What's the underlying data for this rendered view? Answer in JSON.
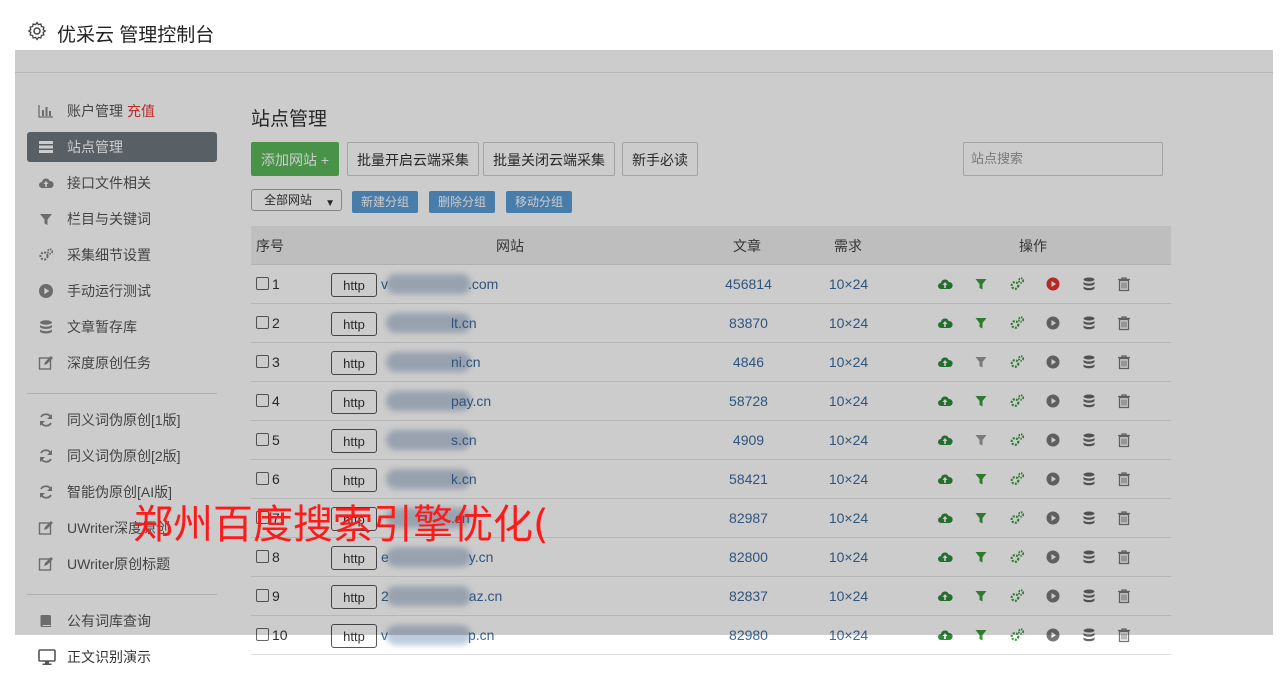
{
  "app": {
    "title": "优采云 管理控制台"
  },
  "sidebar": {
    "items": [
      {
        "label": "账户管理",
        "extra": "充值",
        "icon": "bar-chart-icon"
      },
      {
        "label": "站点管理",
        "icon": "list-icon",
        "active": true
      },
      {
        "label": "接口文件相关",
        "icon": "cloud-upload-icon"
      },
      {
        "label": "栏目与关键词",
        "icon": "filter-icon"
      },
      {
        "label": "采集细节设置",
        "icon": "gears-icon"
      },
      {
        "label": "手动运行测试",
        "icon": "play-circle-icon"
      },
      {
        "label": "文章暂存库",
        "icon": "database-icon"
      },
      {
        "label": "深度原创任务",
        "icon": "edit-icon"
      }
    ],
    "items2": [
      {
        "label": "同义词伪原创[1版]",
        "icon": "refresh-icon"
      },
      {
        "label": "同义词伪原创[2版]",
        "icon": "refresh-icon"
      },
      {
        "label": "智能伪原创[AI版]",
        "icon": "refresh-icon"
      },
      {
        "label": "UWriter深度原创",
        "icon": "edit-icon"
      },
      {
        "label": "UWriter原创标题",
        "icon": "edit-icon"
      }
    ],
    "items3": [
      {
        "label": "公有词库查询",
        "icon": "book-icon"
      }
    ],
    "bottom": {
      "label": "正文识别演示",
      "icon": "monitor-icon"
    }
  },
  "main": {
    "title": "站点管理",
    "buttons": {
      "add_site": "添加网站 +",
      "batch_open": "批量开启云端采集",
      "batch_close": "批量关闭云端采集",
      "newbie": "新手必读"
    },
    "search": {
      "placeholder": "站点搜索"
    },
    "group_select": "全部网站",
    "group_buttons": {
      "new": "新建分组",
      "delete": "删除分组",
      "move": "移动分组"
    },
    "table": {
      "headers": {
        "index": "序号",
        "site": "网站",
        "articles": "文章",
        "demand": "需求",
        "ops": "操作"
      },
      "rows": [
        {
          "num": "1",
          "http": "http",
          "site_prefix": "v",
          "site_suffix": ".com",
          "articles": "456814",
          "demand": "10×24",
          "run_active": true,
          "filter_active": true
        },
        {
          "num": "2",
          "http": "http",
          "site_prefix": "",
          "site_suffix": "lt.cn",
          "articles": "83870",
          "demand": "10×24",
          "run_active": false,
          "filter_active": true
        },
        {
          "num": "3",
          "http": "http",
          "site_prefix": "",
          "site_suffix": "ni.cn",
          "articles": "4846",
          "demand": "10×24",
          "run_active": false,
          "filter_active": false
        },
        {
          "num": "4",
          "http": "http",
          "site_prefix": "",
          "site_suffix": "pay.cn",
          "articles": "58728",
          "demand": "10×24",
          "run_active": false,
          "filter_active": true
        },
        {
          "num": "5",
          "http": "http",
          "site_prefix": "",
          "site_suffix": "s.cn",
          "articles": "4909",
          "demand": "10×24",
          "run_active": false,
          "filter_active": false
        },
        {
          "num": "6",
          "http": "http",
          "site_prefix": "",
          "site_suffix": "k.cn",
          "articles": "58421",
          "demand": "10×24",
          "run_active": false,
          "filter_active": true
        },
        {
          "num": "7",
          "http": "http",
          "site_prefix": "",
          "site_suffix": ".cn",
          "articles": "82987",
          "demand": "10×24",
          "run_active": false,
          "filter_active": true
        },
        {
          "num": "8",
          "http": "http",
          "site_prefix": "e",
          "site_suffix": "y.cn",
          "articles": "82800",
          "demand": "10×24",
          "run_active": false,
          "filter_active": true
        },
        {
          "num": "9",
          "http": "http",
          "site_prefix": "2",
          "site_suffix": "az.cn",
          "articles": "82837",
          "demand": "10×24",
          "run_active": false,
          "filter_active": true
        },
        {
          "num": "10",
          "http": "http",
          "site_prefix": "v",
          "site_suffix": "p.cn",
          "articles": "82980",
          "demand": "10×24",
          "run_active": false,
          "filter_active": true
        }
      ]
    }
  },
  "watermark": "郑州百度搜索引擎优化(",
  "colors": {
    "accent_green": "#5cb85c",
    "link_blue": "#3c6a9e",
    "run_red": "#e0342c",
    "recharge_red": "#e33333"
  }
}
